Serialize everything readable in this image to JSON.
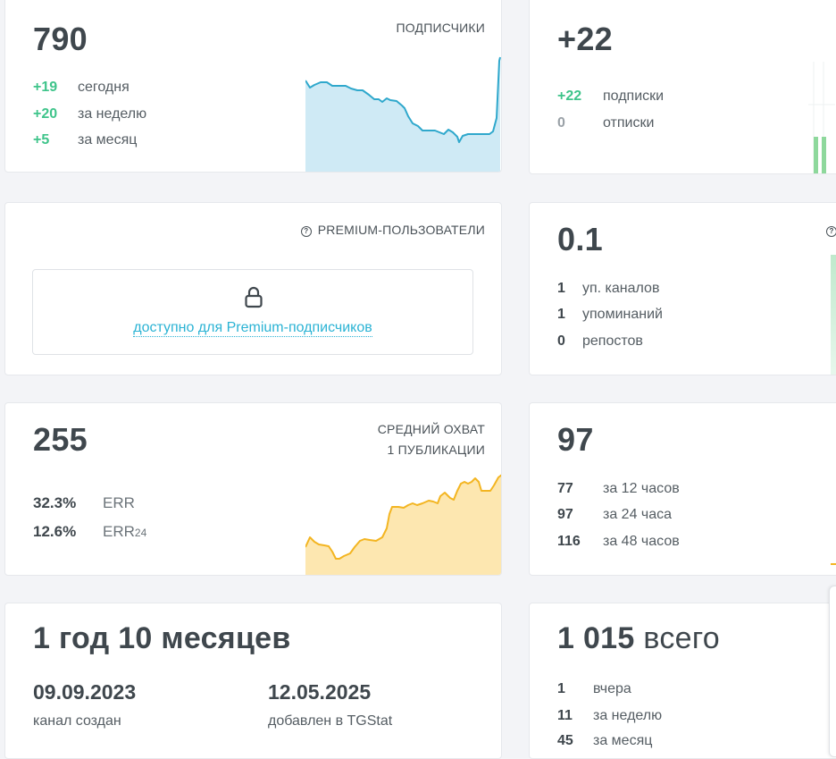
{
  "subscribers": {
    "value": "790",
    "title": "ПОДПИСЧИКИ",
    "rows": [
      {
        "num": "+19",
        "label": "сегодня"
      },
      {
        "num": "+20",
        "label": "за неделю"
      },
      {
        "num": "+5",
        "label": "за месяц"
      }
    ],
    "colors": {
      "line": "#2fa8cc",
      "fill": "#cfeaf5"
    }
  },
  "growth": {
    "value": "+22",
    "rows": [
      {
        "num": "+22",
        "label": "подписки"
      },
      {
        "num": "0",
        "label": "отписки"
      }
    ],
    "colors": {
      "bar": "#8ed89c"
    }
  },
  "premium": {
    "title": "PREMIUM-ПОЛЬЗОВАТЕЛИ",
    "help_icon": "?",
    "lock_icon": "lock-icon",
    "link": "доступно для Premium-подписчиков"
  },
  "citation": {
    "value": "0.1",
    "help_icon": "?",
    "rows": [
      {
        "num": "1",
        "label": "уп. каналов"
      },
      {
        "num": "1",
        "label": "упоминаний"
      },
      {
        "num": "0",
        "label": "репостов"
      }
    ]
  },
  "reach": {
    "value": "255",
    "title_line1": "СРЕДНИЙ ОХВАТ",
    "title_line2": "1 ПУБЛИКАЦИИ",
    "err": {
      "num": "32.3%",
      "label": "ERR"
    },
    "err24": {
      "num": "12.6%",
      "label": "ERR",
      "sub": "24"
    },
    "colors": {
      "line": "#f3b521",
      "fill": "#fde7b0"
    }
  },
  "views": {
    "value": "97",
    "rows": [
      {
        "num": "77",
        "label": "за 12 часов"
      },
      {
        "num": "97",
        "label": "за 24 часа"
      },
      {
        "num": "116",
        "label": "за 48 часов"
      }
    ]
  },
  "age": {
    "value": "1 год 10 месяцев",
    "created_date": "09.09.2023",
    "created_label": "канал создан",
    "added_date": "12.05.2025",
    "added_label": "добавлен в TGStat"
  },
  "posts": {
    "value": "1 015",
    "suffix": "всего",
    "rows": [
      {
        "num": "1",
        "label": "вчера"
      },
      {
        "num": "11",
        "label": "за неделю"
      },
      {
        "num": "45",
        "label": "за месяц"
      }
    ]
  }
}
